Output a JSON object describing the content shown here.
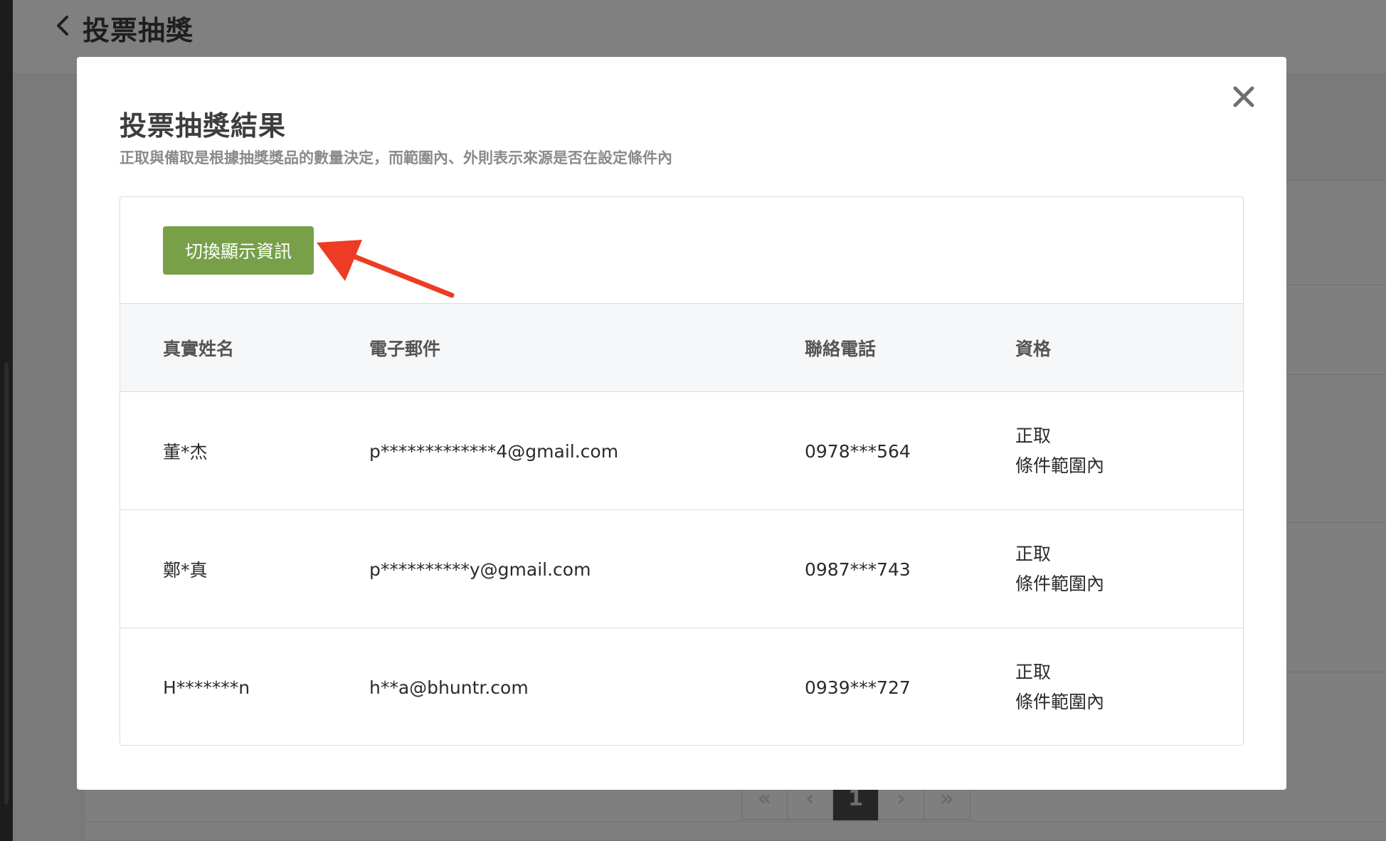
{
  "page": {
    "title": "投票抽獎"
  },
  "background_pager": {
    "first": "«",
    "prev": "‹",
    "current": "1",
    "next": "›",
    "last": "»"
  },
  "modal": {
    "title": "投票抽獎結果",
    "subtitle": "正取與備取是根據抽獎獎品的數量決定，而範圍內、外則表示來源是否在設定條件內",
    "close_icon": "close-icon",
    "toggle_button_label": "切換顯示資訊",
    "accent_color": "#77a049",
    "arrow_color": "#ee3b24",
    "table": {
      "headers": [
        "真實姓名",
        "電子郵件",
        "聯絡電話",
        "資格"
      ],
      "rows": [
        {
          "name": "董*杰",
          "email": "p*************4@gmail.com",
          "phone": "0978***564",
          "status": "正取",
          "scope": "條件範圍內"
        },
        {
          "name": "鄭*真",
          "email": "p**********y@gmail.com",
          "phone": "0987***743",
          "status": "正取",
          "scope": "條件範圍內"
        },
        {
          "name": "H*******n",
          "email": "h**a@bhuntr.com",
          "phone": "0939***727",
          "status": "正取",
          "scope": "條件範圍內"
        }
      ]
    }
  }
}
